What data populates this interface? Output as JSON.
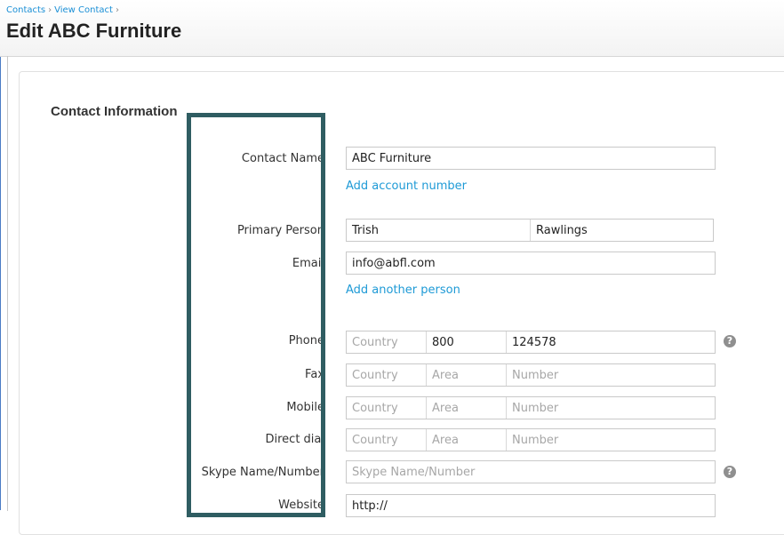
{
  "breadcrumb": {
    "item1": "Contacts",
    "item2": "View Contact",
    "sep": "›"
  },
  "page_title": "Edit ABC Furniture",
  "section_title": "Contact Information",
  "fields": {
    "contact_name": {
      "label": "Contact Name",
      "value": "ABC Furniture"
    },
    "add_account_number": "Add account number",
    "primary_person": {
      "label": "Primary Person",
      "first": "Trish",
      "last": "Rawlings"
    },
    "email": {
      "label": "Email",
      "value": "info@abfl.com"
    },
    "add_another_person": "Add another person",
    "phone": {
      "label": "Phone",
      "country": "Country",
      "area": "800",
      "number": "124578"
    },
    "fax": {
      "label": "Fax",
      "country": "Country",
      "area": "Area",
      "number": "Number"
    },
    "mobile": {
      "label": "Mobile",
      "country": "Country",
      "area": "Area",
      "number": "Number"
    },
    "direct_dial": {
      "label": "Direct dial",
      "country": "Country",
      "area": "Area",
      "number": "Number"
    },
    "skype": {
      "label": "Skype Name/Number",
      "placeholder": "Skype Name/Number"
    },
    "website": {
      "label": "Website",
      "value": "http://"
    }
  },
  "help_icon": "?",
  "colors": {
    "link": "#1e9ad6",
    "highlight": "#2f5d62",
    "placeholder": "#a7a7a7"
  }
}
